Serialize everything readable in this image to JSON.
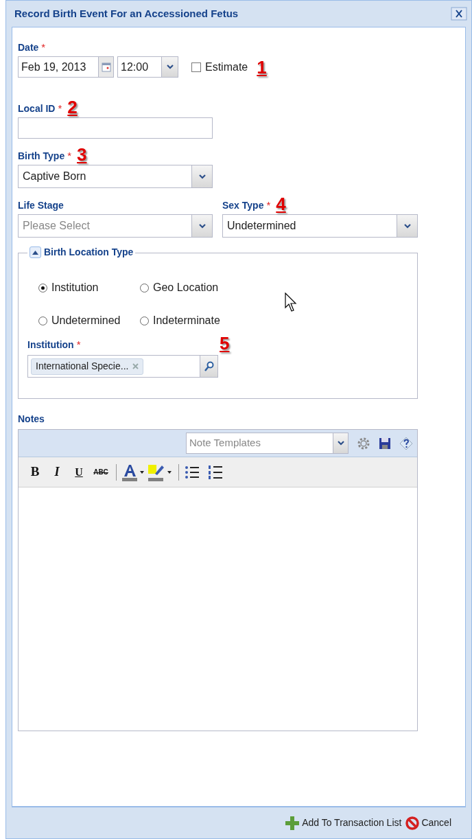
{
  "window": {
    "title": "Record Birth Event For an Accessioned Fetus"
  },
  "date": {
    "label": "Date",
    "required_mark": "*",
    "value": "Feb 19, 2013",
    "time": "12:00",
    "estimate": {
      "label": "Estimate",
      "checked": false
    },
    "marker": "1"
  },
  "local_id": {
    "label": "Local ID",
    "required_mark": "*",
    "marker": "2"
  },
  "birth_type": {
    "label": "Birth Type",
    "required_mark": "*",
    "value": "Captive Born",
    "marker": "3"
  },
  "life_stage": {
    "label": "Life Stage",
    "placeholder": "Please Select"
  },
  "sex_type": {
    "label": "Sex Type",
    "required_mark": "*",
    "value": "Undetermined",
    "marker": "4"
  },
  "birth_location": {
    "legend": "Birth Location Type",
    "expanded": true,
    "options": [
      {
        "label": "Institution",
        "selected": true
      },
      {
        "label": "Geo Location",
        "selected": false
      },
      {
        "label": "Undetermined",
        "selected": false
      },
      {
        "label": "Indeterminate",
        "selected": false
      }
    ],
    "institution": {
      "label": "Institution",
      "required_mark": "*",
      "tag": "International Specie...",
      "marker": "5"
    }
  },
  "notes": {
    "label": "Notes",
    "template_placeholder": "Note Templates",
    "format_buttons": [
      "B",
      "I",
      "U",
      "ABC"
    ]
  },
  "footer": {
    "buttons": [
      "Add To Transaction List",
      "Cancel"
    ]
  }
}
